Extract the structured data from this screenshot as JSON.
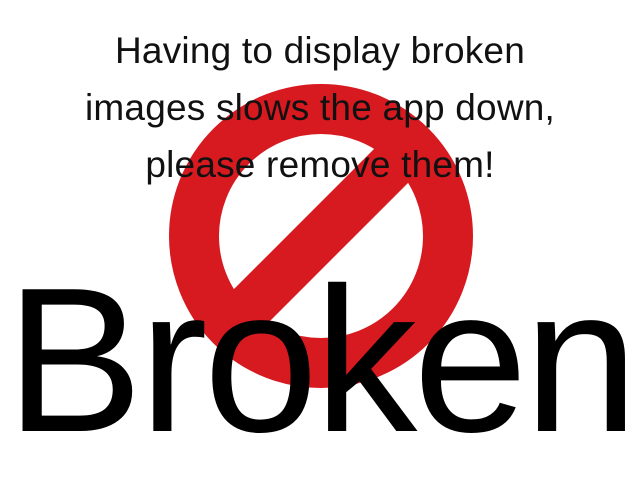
{
  "message": {
    "lines": [
      "Having to display broken",
      "images slows the app down,",
      "please remove them!"
    ]
  },
  "broken_label": "Broken",
  "sign": {
    "icon": "prohibition-icon",
    "color": "#d71920"
  },
  "colors": {
    "background": "#ffffff",
    "message_text": "#111111",
    "broken_text": "#000000"
  }
}
